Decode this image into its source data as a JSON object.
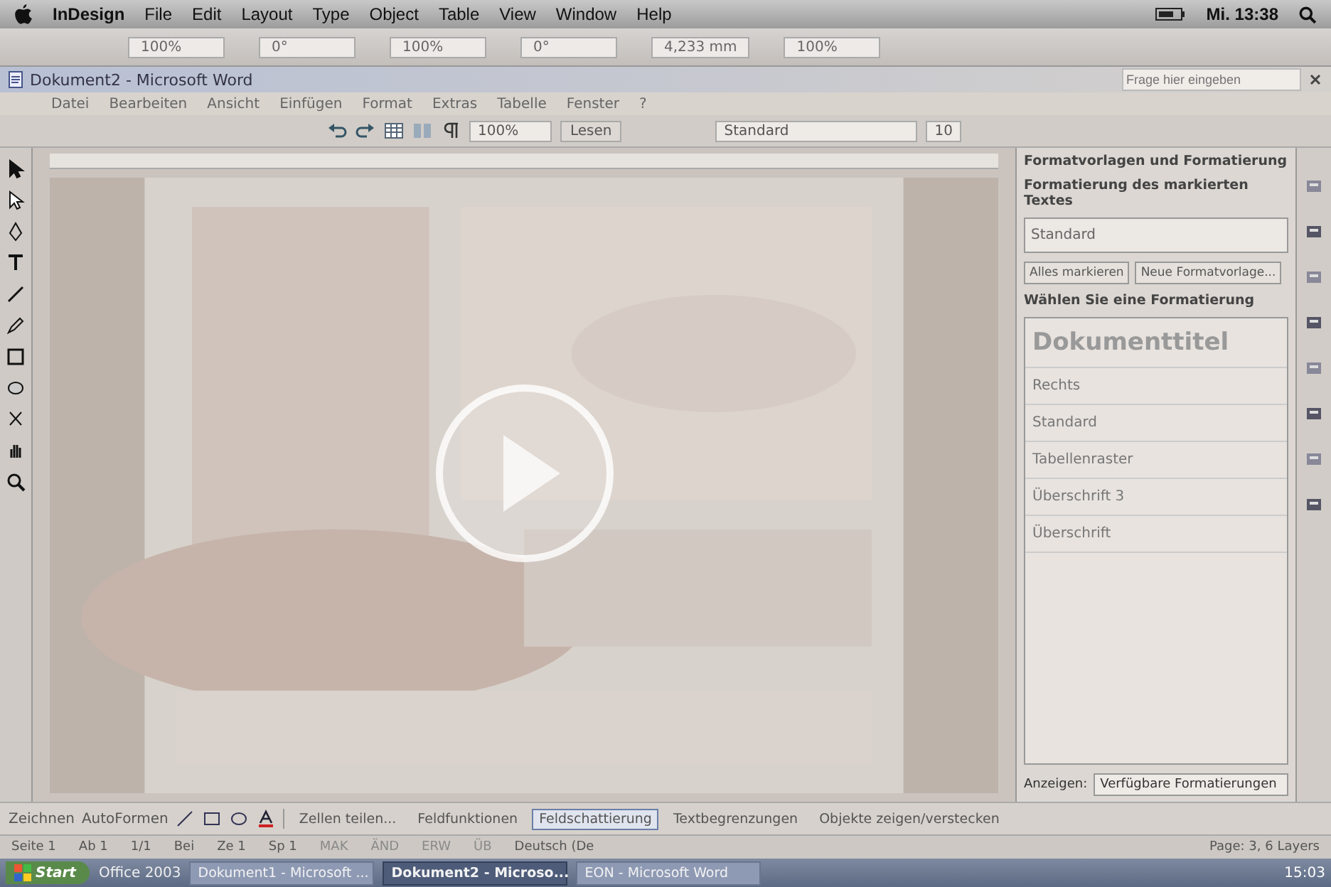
{
  "menu_bar": {
    "items": [
      "InDesign",
      "File",
      "Edit",
      "Layout",
      "Type",
      "Object",
      "Table",
      "View",
      "Window",
      "Help"
    ],
    "clock": "Mi. 13:38"
  },
  "control_bar": {
    "fields": [
      "100%",
      "0°",
      "100%",
      "0°",
      "4,233 mm",
      "100%"
    ]
  },
  "word_window": {
    "title": "Dokument2 - Microsoft Word",
    "menu": [
      "Datei",
      "Bearbeiten",
      "Ansicht",
      "Einfügen",
      "Format",
      "Extras",
      "Tabelle",
      "Fenster",
      "?"
    ],
    "help_placeholder": "Frage hier eingeben",
    "toolbar": {
      "zoom": "100%",
      "read_button": "Lesen",
      "style": "Standard",
      "font_size": "10"
    }
  },
  "task_pane": {
    "title": "Formatvorlagen und Formatierung",
    "selected_heading": "Formatierung des markierten Textes",
    "selected_style": "Standard",
    "buttons": [
      "Alles markieren",
      "Neue Formatvorlage..."
    ],
    "list_heading": "Wählen Sie eine Formatierung",
    "styles": [
      {
        "name": "Dokumenttitel",
        "kind": "title"
      },
      {
        "name": "Rechts",
        "kind": "plain"
      },
      {
        "name": "Standard",
        "kind": "plain"
      },
      {
        "name": "Tabellenraster",
        "kind": "plain"
      },
      {
        "name": "Überschrift 3",
        "kind": "plain"
      },
      {
        "name": "Überschrift",
        "kind": "plain"
      }
    ],
    "show_label": "Anzeigen:",
    "show_value": "Verfügbare Formatierungen"
  },
  "drawing_toolbar": {
    "draw_menu": "Zeichnen",
    "shapes_menu": "AutoFormen"
  },
  "table_toolbar": {
    "items": [
      {
        "label": "Zellen teilen...",
        "selected": false
      },
      {
        "label": "Feldfunktionen",
        "selected": false
      },
      {
        "label": "Feldschattierung",
        "selected": true
      },
      {
        "label": "Textbegrenzungen",
        "selected": false
      },
      {
        "label": "Objekte zeigen/verstecken",
        "selected": false
      }
    ]
  },
  "status_bar": {
    "items": [
      {
        "text": "Seite 1",
        "disabled": false
      },
      {
        "text": "Ab 1",
        "disabled": false
      },
      {
        "text": "1/1",
        "disabled": false
      },
      {
        "text": "Bei",
        "disabled": false
      },
      {
        "text": "Ze 1",
        "disabled": false
      },
      {
        "text": "Sp 1",
        "disabled": false
      },
      {
        "text": "MAK",
        "disabled": true
      },
      {
        "text": "ÄND",
        "disabled": true
      },
      {
        "text": "ERW",
        "disabled": true
      },
      {
        "text": "ÜB",
        "disabled": true
      },
      {
        "text": "Deutsch (De",
        "disabled": false
      }
    ],
    "layers": "Page: 3, 6 Layers"
  },
  "taskbar": {
    "start": "Start",
    "quick_launch": "Office 2003",
    "items": [
      {
        "label": "Dokument1 - Microsoft ...",
        "selected": false
      },
      {
        "label": "Dokument2 - Microso...",
        "selected": true
      },
      {
        "label": "EON - Microsoft Word",
        "selected": false
      }
    ],
    "clock": "15:03"
  }
}
